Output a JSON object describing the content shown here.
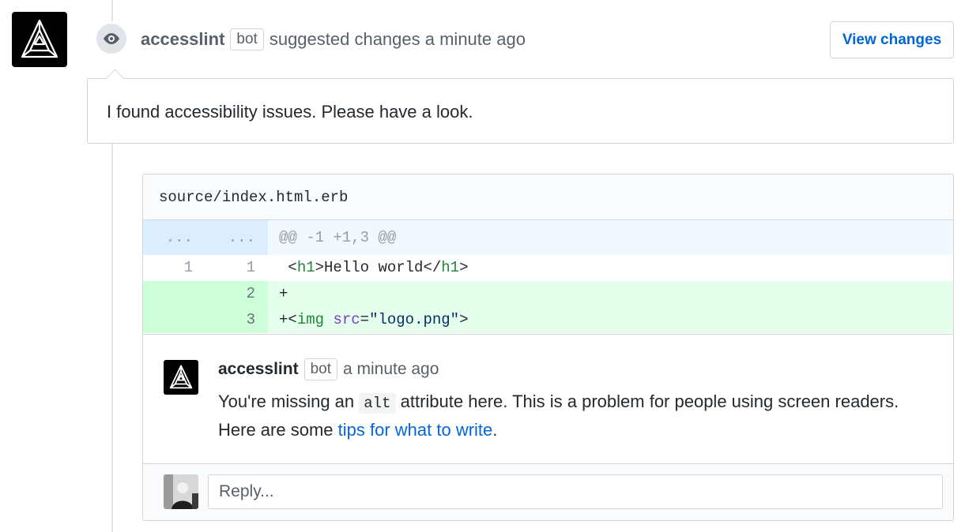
{
  "event": {
    "author": "accesslint",
    "bot_label": "bot",
    "action_text": "suggested changes a minute ago",
    "view_changes_label": "View changes"
  },
  "review": {
    "body": "I found accessibility issues. Please have a look."
  },
  "file": {
    "path": "source/index.html.erb",
    "hunk": {
      "old_num": "...",
      "new_num": "...",
      "header": "@@ -1 +1,3 @@"
    },
    "lines": [
      {
        "old": "1",
        "new": "1",
        "type": "context"
      },
      {
        "old": "",
        "new": "2",
        "type": "addition",
        "text": "+"
      },
      {
        "old": "",
        "new": "3",
        "type": "addition"
      }
    ]
  },
  "inline_comment": {
    "author": "accesslint",
    "bot_label": "bot",
    "time": "a minute ago",
    "body_before": "You're missing an",
    "code": "alt",
    "body_middle": "attribute here. This is a problem for people using screen readers. Here are some",
    "link_text": "tips for what to write",
    "body_after": "."
  },
  "reply": {
    "placeholder": "Reply..."
  },
  "icons": {
    "event": "eye-icon",
    "avatar": "accesslint-logo-icon"
  }
}
